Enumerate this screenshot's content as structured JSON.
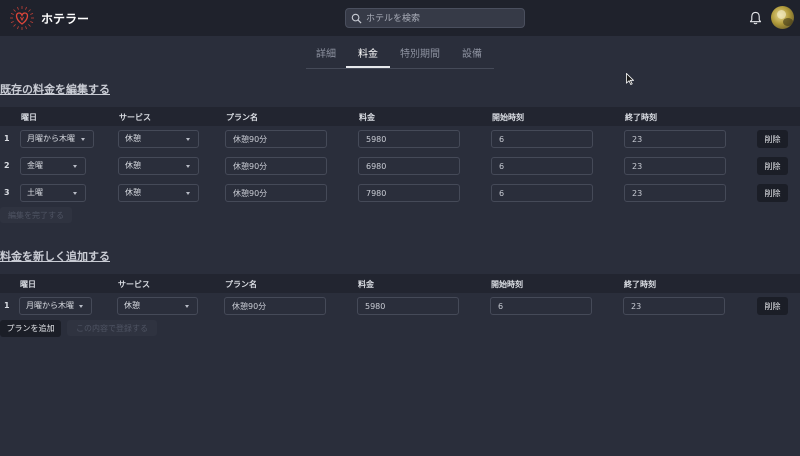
{
  "header": {
    "app_title": "ホテラー",
    "search_placeholder": "ホテルを検索"
  },
  "tabs": [
    {
      "label": "詳細",
      "active": false
    },
    {
      "label": "料金",
      "active": true
    },
    {
      "label": "特別期間",
      "active": false
    },
    {
      "label": "設備",
      "active": false
    }
  ],
  "edit_section": {
    "title": "既存の料金を編集する",
    "columns": [
      "曜日",
      "サービス",
      "プラン名",
      "料金",
      "開始時刻",
      "終了時刻"
    ],
    "rows": [
      {
        "index": "1",
        "day": "月曜から木曜",
        "service": "休憩",
        "plan": "休憩90分",
        "price": "5980",
        "start": "6",
        "end": "23",
        "delete": "削除"
      },
      {
        "index": "2",
        "day": "金曜",
        "service": "休憩",
        "plan": "休憩90分",
        "price": "6980",
        "start": "6",
        "end": "23",
        "delete": "削除"
      },
      {
        "index": "3",
        "day": "土曜",
        "service": "休憩",
        "plan": "休憩90分",
        "price": "7980",
        "start": "6",
        "end": "23",
        "delete": "削除"
      }
    ],
    "complete_button": "編集を完了する"
  },
  "add_section": {
    "title": "料金を新しく追加する",
    "columns": [
      "曜日",
      "サービス",
      "プラン名",
      "料金",
      "開始時刻",
      "終了時刻"
    ],
    "rows": [
      {
        "index": "1",
        "day": "月曜から木曜",
        "service": "休憩",
        "plan": "休憩90分",
        "price": "5980",
        "start": "6",
        "end": "23",
        "delete": "削除"
      }
    ],
    "add_plan_button": "プランを追加",
    "register_button": "この内容で登録する"
  },
  "colors": {
    "background": "#2a2e3b",
    "header": "#1f222c",
    "table_head": "#222530",
    "accent": "#e0463a"
  }
}
